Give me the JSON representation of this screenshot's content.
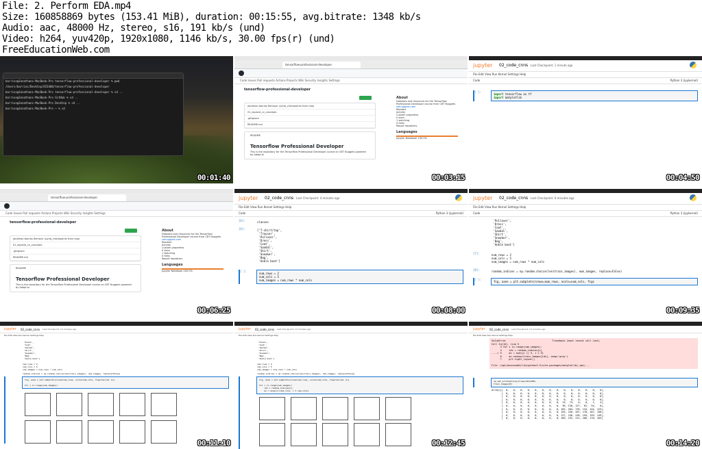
{
  "header": {
    "line1": "File: 2. Perform EDA.mp4",
    "line2": "Size: 160858869 bytes (153.41 MiB), duration: 00:15:55, avg.bitrate: 1348 kb/s",
    "line3": "Audio: aac, 48000 Hz, stereo, s16, 191 kb/s (und)",
    "line4": "Video: h264, yuv420p, 1920x1080, 1146 kb/s, 30.00 fps(r) (und)",
    "line5": "FreeEducationWeb.com"
  },
  "thumbnails": [
    {
      "timestamp": "00:01:40"
    },
    {
      "timestamp": "00:03:15"
    },
    {
      "timestamp": "00:04:50"
    },
    {
      "timestamp": "00:06:25"
    },
    {
      "timestamp": "00:08:00"
    },
    {
      "timestamp": "00:09:35"
    },
    {
      "timestamp": "00:11:10"
    },
    {
      "timestamp": "00:12:45"
    },
    {
      "timestamp": "00:14:20"
    }
  ],
  "terminal": {
    "lines": [
      "barrios@Jonathans-MacBook-Pro tensorflow-professional-developer % pwd",
      "/Users/barrios/Desktop/ECE460/tensorflow-professional-developer",
      "barrios@Jonathans-MacBook-Pro tensorflow-professional-developer % cd ..",
      "barrios@Jonathans-MacBook-Pro GitHub % cd ..",
      "barrios@Jonathans-MacBook-Pro Desktop % cd ..",
      "barrios@Jonathans-MacBook-Pro ~ % cd"
    ]
  },
  "github": {
    "repo_name": "tensorflow-professional-developer",
    "visibility": "Public",
    "nav": "Code   Issues   Pull requests   Actions   Projects   Wiki   Security   Insights   Settings",
    "branch": "main",
    "code_button": "Code",
    "files": [
      "jonathan-barrios  Remove .ipynb_checkpoints from repo",
      "01_explore_cv_concepts",
      ".gitignore",
      "README.md"
    ],
    "readme_label": "README",
    "readme_title": "Tensorflow Professional Developer",
    "readme_text": "This is the repository for the Tensorflow Professional Developer course on CBT Nuggets powered by Adapt.ai",
    "about_title": "About",
    "about_text": "Datasets and resources for the Tensorflow Professional Developer course from CBT Nuggets",
    "about_link": "cbtnuggets.com",
    "about_items": [
      "Readme",
      "Activity",
      "Custom properties",
      "0 stars",
      "1 watching",
      "0 forks",
      "Report repository"
    ],
    "languages_title": "Languages",
    "languages_item": "Jupyter Notebook 100.0%"
  },
  "jupyter": {
    "logo": "jupyter",
    "notebook_name": "02_code_cnns",
    "menu": "File   Edit   View   Run   Kernel   Settings   Help",
    "toolbar_mode": "Code",
    "kernel_label": "JupyterLab",
    "kernel": "Python 3 (ipykernel)",
    "trusted": "Trusted",
    "thumb3": {
      "checkpoint": "Last Checkpoint: 1 minute ago",
      "prompt": "[ ]:",
      "code_kw1": "import",
      "code_rest1": " tensorflow as tf",
      "code_kw2": "import",
      "code_rest2": " matplotlib"
    },
    "thumb5": {
      "checkpoint": "Last Checkpoint: 4 minutes ago",
      "prompt1": "[6]:",
      "code1": "classes",
      "prompt2": "[6]:",
      "out": "['T-shirt/top',\n 'Trouser',\n 'Pullover',\n 'Dress',\n 'Coat',\n 'Sandal',\n 'Shirt',\n 'Sneaker',\n 'Bag',\n 'Ankle boot']",
      "prompt3": "[ ]:",
      "code3": "num_rows = 2\nnum_cols = 5\nnum_images = num_rows * num_cols"
    },
    "thumb6": {
      "checkpoint": "Last Checkpoint: 6 minutes ago",
      "out": " 'Pullover',\n 'Dress',\n 'Coat',\n 'Sandal',\n 'Shirt',\n 'Sneaker',\n 'Bag',\n 'Ankle boot']",
      "prompt1": "[7]:",
      "code1": "num_rows = 2\nnum_cols = 5\nnum_images = num_rows * num_cols",
      "prompt2": "[8]:",
      "code2": "random_indices = np.random.choice(len(train_images), num_images, replace=False)",
      "prompt3": "[ ]:",
      "code3": "fig, axes = plt.subplots(nrows=num_rows, ncols=num_cols, figs"
    },
    "thumb7": {
      "checkpoint": "Last Checkpoint: 10 minutes ago",
      "out": " 'Dress',\n 'Coat',\n 'Sandal',\n 'Shirt',\n 'Sneaker',\n 'Bag',\n 'Ankle boot']",
      "code1": "num_rows = 2\nnum_cols = 5\nnum_images = num_rows * num_cols",
      "code2": "random_indices = np.random.choice(len(train_images), num_images, replace=False)",
      "code3": "fig, axes = plt.subplots(nrows=num_rows, ncols=num_cols, figsize=(12, 6))\n\nfor i in range(num_images):"
    },
    "thumb8": {
      "checkpoint": "Last Checkpoint: 12 minutes ago",
      "out": " 'Dress',\n 'Coat',\n 'Sandal',\n 'Shirt',\n 'Sneaker',\n 'Bag',\n 'Ankle boot']",
      "code1": "num_rows = 2\nnum_cols = 5\nnum_images = num_rows * num_cols",
      "code2": "random_indices = np.random.choice(len(train_images), num_images, replace=False)",
      "code3": "fig, axes = plt.subplots(nrows=num_rows, ncols=num_cols, figsize=(12, 6))\n\nfor i in range(num_images):\n    idx = random_indices[i]\n    ax = axes[i//num_cols, i % num_cols]"
    },
    "thumb9": {
      "checkpoint": "Last Checkpoint: 14 minutes ago",
      "error": "ValueError                                Traceback (most recent call last)\nCell In[10], line 5\n      3 for i in range(num_images):\n      4     idx = random_indices[i]\n----> 5     ax = axes[i // 5, i % 5]\n      6     ax.imshow(train_images[idx], cmap='gray')\n      7     plt.tight_layout()\n\nFile ~/opt/anaconda3/lib/python3.9/site-packages/matplotlib/_api/...",
      "code": "np.set_printoptions(linewidth=200)\ntrain_images[0]",
      "out": "array([[  0,   0,   0,   0,   0,   0,   0,   0,   0,   0,   0,   0,   0,   0],\n       [  0,   0,   0,   0,   0,   0,   0,   0,   0,   0,   0,   0,   0,   0],\n       [  0,   0,   0,   0,   0,   0,   0,   0,   0,   0,   0,   0,   0,   0],\n       [  0,   0,   0,   0,   0,   0,   0,   0,   0,   0,   0,   0,   0,   0],\n       [  0,   0,   0,   0,   0,   0,   0,   0,  13,  73,   0,   0,   1,   4],\n       [  0,   0,   0,   0,   0,   0,   0,   0,  36, 136, 127,  62,  54,   0],\n       [  0,   0,   0,   0,   0,   0,   0,   0, 102, 204, 176, 134, 144, 123],\n       [  0,   0,   0,   0,   0,   0,   0,   0, 155, 236, 207, 178, 107, 156],\n       [  0,   0,   0,   0,   0,   0,   0,   0, 127, 246, 228, 194, 159, 149],\n       [  0,   0,   0,   0,   0,   0,   0,   0, 189, 232, 221, 206, 170, 163]"
    }
  }
}
